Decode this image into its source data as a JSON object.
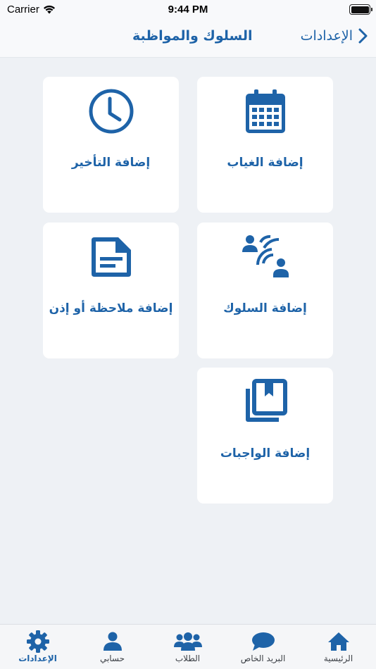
{
  "status_bar": {
    "carrier": "Carrier",
    "time": "9:44 PM"
  },
  "nav": {
    "title": "السلوك والمواظبة",
    "back_label": "الإعدادات"
  },
  "cards": {
    "absence": "إضافة الغياب",
    "lateness": "إضافة التأخير",
    "behavior": "إضافة السلوك",
    "note": "إضافة ملاحظة أو إذن",
    "homework": "إضافة الواجبات"
  },
  "tabs": {
    "home": "الرئيسية",
    "mail": "البريد الخاص",
    "students": "الطلاب",
    "account": "حسابي",
    "settings": "الإعدادات"
  },
  "colors": {
    "accent": "#1e63a8",
    "background": "#eef1f5",
    "card": "#ffffff"
  },
  "icons": {
    "absence": "calendar-icon",
    "lateness": "clock-icon",
    "behavior": "people-communication-icon",
    "note": "document-icon",
    "homework": "bookmark-copy-icon"
  }
}
